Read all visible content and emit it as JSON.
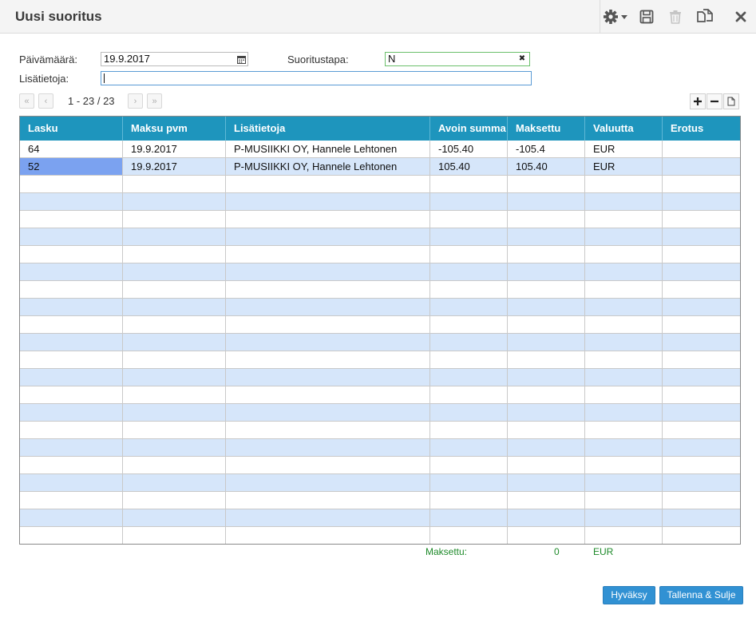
{
  "window": {
    "title": "Uusi suoritus"
  },
  "toolbar": {
    "icons": [
      "gear-dropdown-icon",
      "save-icon",
      "trash-icon",
      "copy-icon",
      "close-icon"
    ]
  },
  "form": {
    "date_label": "Päivämäärä:",
    "date_value": "19.9.2017",
    "method_label": "Suoritustapa:",
    "method_value": "N",
    "info_label": "Lisätietoja:",
    "info_value": ""
  },
  "pager": {
    "range": "1 - 23 / 23"
  },
  "grid": {
    "columns": [
      "Lasku",
      "Maksu pvm",
      "Lisätietoja",
      "Avoin summa",
      "Maksettu",
      "Valuutta",
      "Erotus"
    ],
    "rows": [
      [
        "64",
        "19.9.2017",
        "P-MUSIIKKI OY, Hannele Lehtonen",
        "-105.40",
        "-105.4",
        "EUR",
        ""
      ],
      [
        "52",
        "19.9.2017",
        "P-MUSIIKKI OY, Hannele Lehtonen",
        "105.40",
        "105.40",
        "EUR",
        ""
      ]
    ],
    "selected_row": 1,
    "colors": {
      "header": "#1e95bd",
      "alt_row": "#d6e6fa",
      "selected_cell": "#7ba2f0"
    }
  },
  "summary": {
    "label": "Maksettu:",
    "value": "0",
    "currency": "EUR"
  },
  "buttons": {
    "approve": "Hyväksy",
    "save_close": "Tallenna & Sulje"
  }
}
